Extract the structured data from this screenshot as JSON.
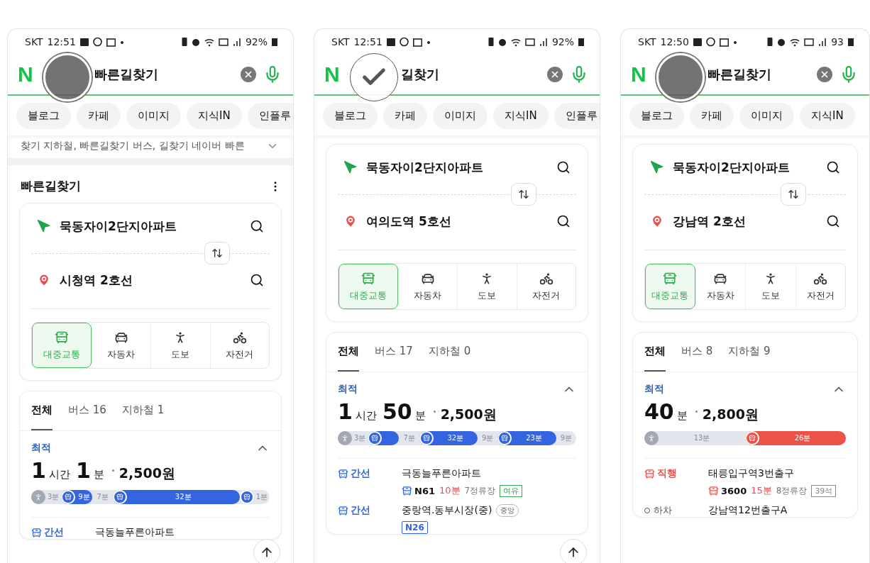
{
  "phones": [
    {
      "status": {
        "carrier": "SKT",
        "time": "12:51",
        "battery": "92%"
      },
      "touch": {
        "kind": "press"
      },
      "header": {
        "logo": "N",
        "query": "빠른길찾기"
      },
      "chips": [
        "블로그",
        "카페",
        "이미지",
        "지식IN",
        "인플루"
      ],
      "related": "찾기 지하철, 빠른길찾기 버스, 길찾기 네이버 빠른",
      "section_title": "빠른길찾기",
      "route": {
        "origin": "묵동자이2단지아파트",
        "destination": "시청역 2호선"
      },
      "modes": [
        {
          "kind": "transit",
          "label": "대중교통",
          "selected": true
        },
        {
          "kind": "car",
          "label": "자동차",
          "selected": false
        },
        {
          "kind": "walk",
          "label": "도보",
          "selected": false
        },
        {
          "kind": "bike",
          "label": "자전거",
          "selected": false
        }
      ],
      "result_tabs": [
        {
          "label": "전체",
          "selected": true
        },
        {
          "label": "버스 16",
          "selected": false
        },
        {
          "label": "지하철 1",
          "selected": false
        }
      ],
      "best": {
        "label": "최적",
        "time": [
          {
            "kind": "num",
            "text": "1"
          },
          {
            "kind": "unit",
            "text": "시간"
          },
          {
            "kind": "num",
            "text": "1"
          },
          {
            "kind": "unit",
            "text": "분"
          }
        ],
        "fare": "2,500원"
      },
      "timeline": [
        {
          "kind": "walk",
          "text": "3분"
        },
        {
          "kind": "ride",
          "text": "9분",
          "color": "#3564e0"
        },
        {
          "kind": "gap",
          "text": "7분"
        },
        {
          "kind": "ride",
          "text": "32분",
          "color": "#3564e0",
          "long": true
        },
        {
          "kind": "end",
          "text": "1분",
          "color": "#3564e0"
        }
      ],
      "legs": [
        {
          "kind": "ride",
          "type": "간선",
          "color": "#3564e0",
          "stop": "극동늘푸른아파트"
        }
      ],
      "scroll_top": true
    },
    {
      "status": {
        "carrier": "SKT",
        "time": "12:51",
        "battery": "92%"
      },
      "touch": {
        "kind": "check"
      },
      "header": {
        "logo": "N",
        "query": "길찾기"
      },
      "chips": [
        "블로그",
        "카페",
        "이미지",
        "지식IN",
        "인플루"
      ],
      "route": {
        "origin": "묵동자이2단지아파트",
        "destination": "여의도역 5호선"
      },
      "modes": [
        {
          "kind": "transit",
          "label": "대중교통",
          "selected": true
        },
        {
          "kind": "car",
          "label": "자동차",
          "selected": false
        },
        {
          "kind": "walk",
          "label": "도보",
          "selected": false
        },
        {
          "kind": "bike",
          "label": "자전거",
          "selected": false
        }
      ],
      "result_tabs": [
        {
          "label": "전체",
          "selected": true
        },
        {
          "label": "버스 17",
          "selected": false
        },
        {
          "label": "지하철 0",
          "selected": false
        }
      ],
      "best": {
        "label": "최적",
        "time": [
          {
            "kind": "num",
            "text": "1"
          },
          {
            "kind": "unit",
            "text": "시간"
          },
          {
            "kind": "num",
            "text": "50"
          },
          {
            "kind": "unit",
            "text": "분"
          }
        ],
        "fare": "2,500원"
      },
      "timeline": [
        {
          "kind": "walk",
          "text": "3분"
        },
        {
          "kind": "ride",
          "color": "#3564e0"
        },
        {
          "kind": "gap",
          "text": "7분"
        },
        {
          "kind": "ride",
          "text": "32분",
          "color": "#3564e0",
          "long": true
        },
        {
          "kind": "gap",
          "text": "9분"
        },
        {
          "kind": "ride",
          "text": "23분",
          "color": "#3564e0",
          "long": true
        },
        {
          "kind": "gap",
          "text": "9분"
        }
      ],
      "legs": [
        {
          "kind": "ride",
          "type": "간선",
          "color": "#3564e0",
          "stop": "극동늘푸른아파트",
          "route": "N61",
          "boxed": false,
          "wait": "10분",
          "stops": "7정류장",
          "tag": {
            "text": "여유",
            "color": "#3aa455"
          }
        },
        {
          "kind": "ride",
          "type": "간선",
          "color": "#3564e0",
          "stop": "중랑역.동부시장(중)",
          "stop_tag": "중앙",
          "route": "N26",
          "boxed": true
        }
      ],
      "scroll_top": true
    },
    {
      "status": {
        "carrier": "SKT",
        "time": "12:50",
        "battery": "93"
      },
      "touch": {
        "kind": "press"
      },
      "header": {
        "logo": "N",
        "query": "빠른길찾기"
      },
      "chips": [
        "블로그",
        "카페",
        "이미지",
        "지식IN"
      ],
      "route": {
        "origin": "묵동자이2단지아파트",
        "destination": "강남역 2호선"
      },
      "modes": [
        {
          "kind": "transit",
          "label": "대중교통",
          "selected": true
        },
        {
          "kind": "car",
          "label": "자동차",
          "selected": false
        },
        {
          "kind": "walk",
          "label": "도보",
          "selected": false
        },
        {
          "kind": "bike",
          "label": "자전거",
          "selected": false
        }
      ],
      "result_tabs": [
        {
          "label": "전체",
          "selected": true
        },
        {
          "label": "버스 8",
          "selected": false
        },
        {
          "label": "지하철 9",
          "selected": false
        }
      ],
      "best": {
        "label": "최적",
        "time": [
          {
            "kind": "num",
            "text": "40"
          },
          {
            "kind": "unit",
            "text": "분"
          }
        ],
        "fare": "2,800원"
      },
      "timeline": [
        {
          "kind": "walk",
          "text": "13분",
          "long": true
        },
        {
          "kind": "ride",
          "text": "26분",
          "color": "#ee5148",
          "long": true
        }
      ],
      "legs": [
        {
          "kind": "ride",
          "type": "직행",
          "color": "#ee5148",
          "stop": "태릉입구역3번출구",
          "route": "3600",
          "boxed": false,
          "wait": "15분",
          "stops": "8정류장",
          "tag": {
            "text": "39석",
            "color": "#888888"
          }
        },
        {
          "kind": "alight",
          "type": "하차",
          "stop": "강남역12번출구A"
        }
      ],
      "scroll_top": false
    }
  ]
}
